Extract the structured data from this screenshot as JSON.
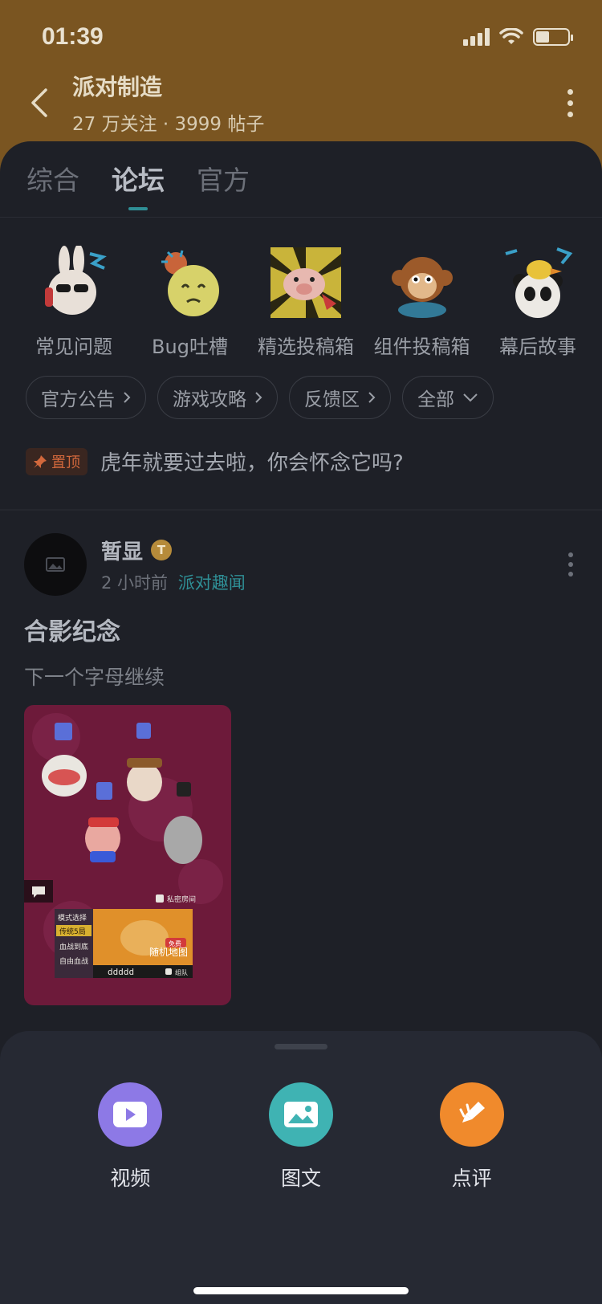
{
  "status_bar": {
    "time": "01:39"
  },
  "forum": {
    "title": "派对制造",
    "subtitle": "27 万关注 · 3999 帖子"
  },
  "tabs": [
    {
      "label": "综合",
      "active": false
    },
    {
      "label": "论坛",
      "active": true
    },
    {
      "label": "官方",
      "active": false
    }
  ],
  "categories": [
    {
      "label": "常见问题",
      "icon": "rabbit-sticker-icon"
    },
    {
      "label": "Bug吐槽",
      "icon": "crying-face-sticker-icon"
    },
    {
      "label": "精选投稿箱",
      "icon": "pig-sticker-icon"
    },
    {
      "label": "组件投稿箱",
      "icon": "monkey-sticker-icon"
    },
    {
      "label": "幕后故事",
      "icon": "panda-sticker-icon"
    }
  ],
  "filters": [
    {
      "label": "官方公告",
      "icon": "chevron-right-icon"
    },
    {
      "label": "游戏攻略",
      "icon": "chevron-right-icon"
    },
    {
      "label": "反馈区",
      "icon": "chevron-right-icon"
    },
    {
      "label": "全部",
      "icon": "chevron-down-icon"
    }
  ],
  "pinned": {
    "badge": "置顶",
    "text": "虎年就要过去啦，你会怀念它吗?"
  },
  "post": {
    "author": "暂显",
    "level_badge": "T",
    "time": "2 小时前",
    "tag": "派对趣闻",
    "title": "合影纪念",
    "description": "下一个字母继续",
    "image": {
      "labels": {
        "private_room": "私密房间",
        "mode_title": "模式选择",
        "mode_traditional": "传统5局",
        "mode_blood": "血战到底",
        "mode_free": "自由血战",
        "random_map": "随机地图",
        "free": "免费",
        "room_code": "ddddd",
        "team": "组队"
      }
    }
  },
  "bottom_actions": [
    {
      "label": "视频",
      "color": "#8d79e6",
      "icon": "video-play-icon"
    },
    {
      "label": "图文",
      "color": "#3fb3b3",
      "icon": "image-icon"
    },
    {
      "label": "点评",
      "color": "#f08a2c",
      "icon": "review-pen-icon"
    }
  ]
}
